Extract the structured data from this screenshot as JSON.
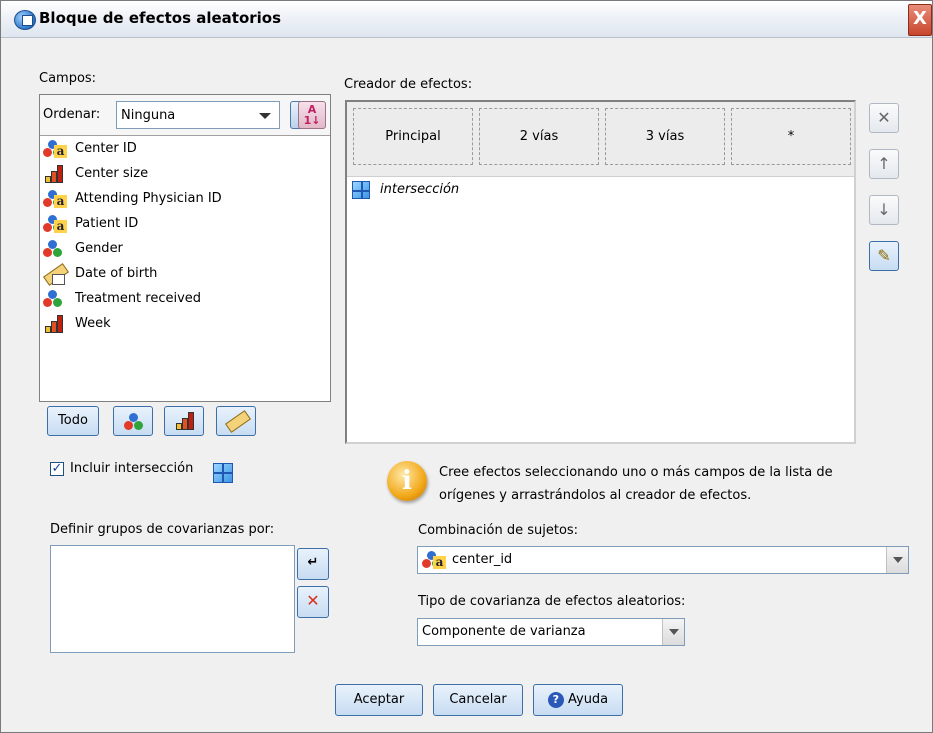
{
  "window": {
    "title": "Bloque de efectos aleatorios",
    "close_glyph": "X"
  },
  "fields": {
    "label": "Campos:",
    "sort_label": "Ordenar:",
    "sort_value": "Ninguna",
    "items": [
      {
        "label": "Center ID",
        "icon": "nominal-string-icon"
      },
      {
        "label": "Center size",
        "icon": "scale-icon"
      },
      {
        "label": "Attending Physician ID",
        "icon": "nominal-string-icon"
      },
      {
        "label": "Patient ID",
        "icon": "nominal-string-icon"
      },
      {
        "label": "Gender",
        "icon": "nominal-icon"
      },
      {
        "label": "Date of birth",
        "icon": "date-icon"
      },
      {
        "label": "Treatment received",
        "icon": "nominal-icon"
      },
      {
        "label": "Week",
        "icon": "scale-icon"
      }
    ],
    "filter_all_label": "Todo"
  },
  "builder": {
    "label": "Creador de efectos:",
    "columns": [
      "Principal",
      "2 vías",
      "3 vías",
      "*"
    ],
    "items": [
      "intersección"
    ]
  },
  "include_intercept": {
    "label": "Incluir intersección",
    "checked": true,
    "check_glyph": "✓"
  },
  "info": {
    "icon_glyph": "i",
    "text_line1": "Cree efectos seleccionando uno o más campos de la lista de",
    "text_line2": "orígenes y arrastrándolos al creador de efectos."
  },
  "covariance_groups": {
    "label": "Definir grupos de covarianzas por:"
  },
  "subject_combo": {
    "label": "Combinación de sujetos:",
    "value": "center_id"
  },
  "covariance_type": {
    "label": "Tipo de covarianza de efectos aleatorios:",
    "value": "Componente de varianza"
  },
  "buttons": {
    "ok": "Aceptar",
    "cancel": "Cancelar",
    "help": "Ayuda"
  },
  "colors": {
    "accent": "#3c6ea8",
    "intercept": "#1e58b3",
    "info": "#f2a818"
  }
}
